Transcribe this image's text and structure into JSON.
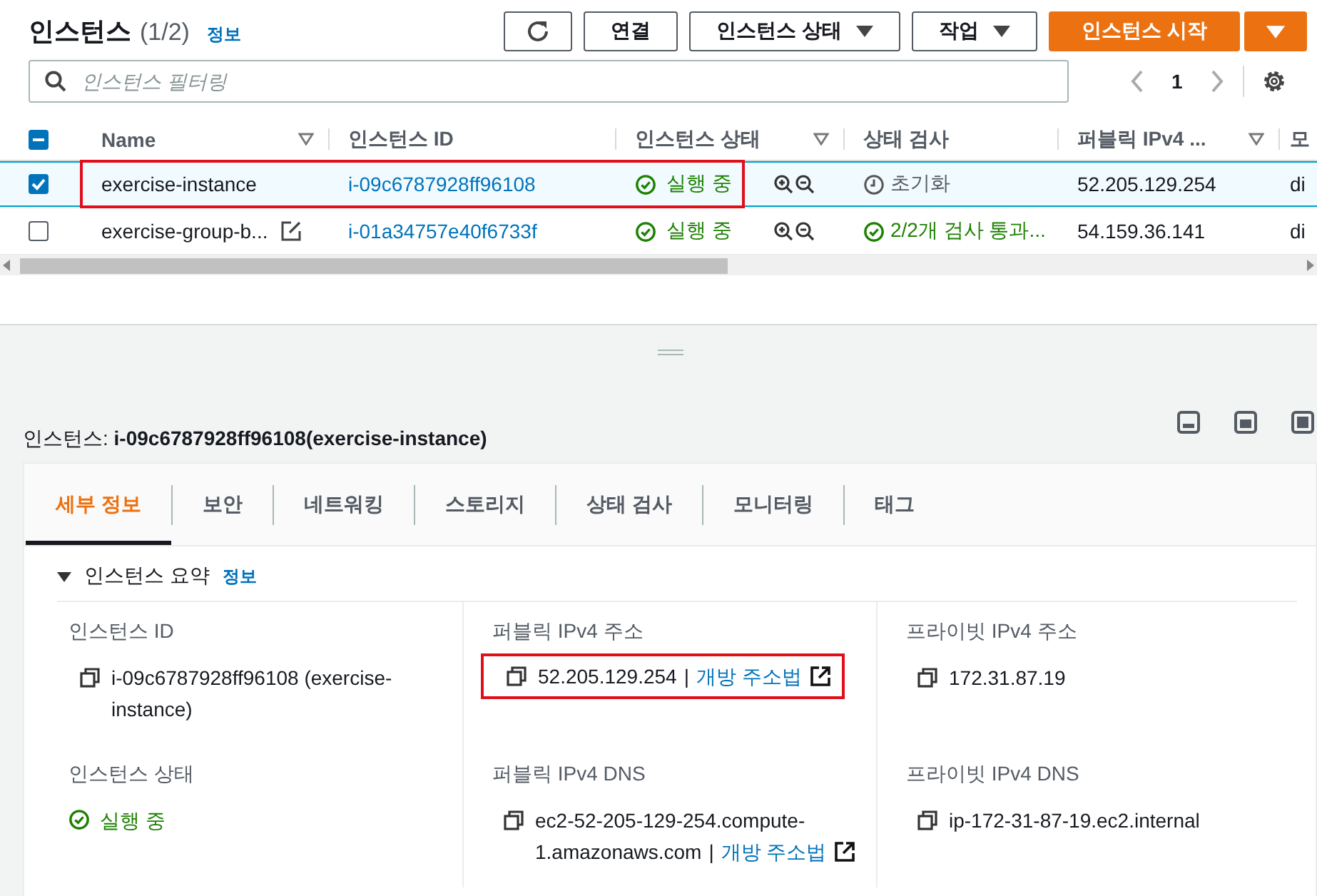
{
  "header": {
    "title": "인스턴스",
    "count": "(1/2)",
    "info": "정보"
  },
  "actions": [
    {
      "kind": "icon"
    },
    {
      "kind": "plain",
      "label": "연결"
    },
    {
      "kind": "dropdown",
      "label": "인스턴스 상태"
    },
    {
      "kind": "dropdown",
      "label": "작업"
    },
    {
      "kind": "primary",
      "label": "인스턴스 시작"
    },
    {
      "kind": "primary-caret"
    }
  ],
  "filter": {
    "placeholder": "인스턴스 필터링"
  },
  "pagination": {
    "page": "1"
  },
  "table": {
    "partially_checked": true,
    "columns": [
      {
        "label": "Name",
        "filter": true
      },
      {
        "label": "인스턴스 ID",
        "filter": false
      },
      {
        "label": "인스턴스 상태",
        "filter": true
      },
      {
        "label": "상태 검사",
        "filter": false
      },
      {
        "label": "퍼블릭 IPv4 ...",
        "filter": true
      },
      {
        "label": "모",
        "filter": false
      }
    ],
    "rows": [
      {
        "selected": true,
        "highlighted": true,
        "name": "exercise-instance",
        "editable": false,
        "id": "i-09c6787928ff96108",
        "state": "실행 중",
        "check": {
          "kind": "pending",
          "text": "초기화"
        },
        "ip": "52.205.129.254",
        "column_7": "di"
      },
      {
        "selected": false,
        "highlighted": false,
        "name": "exercise-group-b...",
        "editable": true,
        "id": "i-01a34757e40f6733f",
        "state": "실행 중",
        "check": {
          "kind": "passed",
          "text": "2/2개 검사 통과..."
        },
        "ip": "54.159.36.141",
        "column_7": "di"
      }
    ]
  },
  "detail": {
    "title": "인스턴스: **i-09c6787928ff96108(exercise-instance)**",
    "tabs": [
      {
        "label": "세부 정보",
        "selected": true
      },
      {
        "label": "보안",
        "selected": false
      },
      {
        "label": "네트워킹",
        "selected": false
      },
      {
        "label": "스토리지",
        "selected": false
      },
      {
        "label": "상태 검사",
        "selected": false
      },
      {
        "label": "모니터링",
        "selected": false
      },
      {
        "label": "태그",
        "selected": false
      }
    ],
    "section": {
      "title": "인스턴스 요약",
      "info": "정보",
      "expanded": true
    },
    "fields": [
      {
        "label": "인스턴스 ID",
        "kind": "copy",
        "value": "i-09c6787928ff96108 (exercise-instance)",
        "highlighted": false
      },
      {
        "label": "퍼블릭 IPv4 주소",
        "kind": "copy",
        "value": "52.205.129.254",
        "separator": "|",
        "link": "개방 주소법",
        "highlighted": true
      },
      {
        "label": "프라이빗 IPv4 주소",
        "kind": "copy",
        "value": "172.31.87.19",
        "highlighted": false
      },
      {
        "label": "인스턴스 상태",
        "kind": "status",
        "value": "실행 중",
        "highlighted": false
      },
      {
        "label": "퍼블릭 IPv4 DNS",
        "kind": "copy",
        "value": "ec2-52-205-129-254.compute-1.amazonaws.com",
        "separator": "|",
        "link": "개방 주소법",
        "highlighted": false
      },
      {
        "label": "프라이빗 IPv4 DNS",
        "kind": "copy",
        "value": "ip-172-31-87-19.ec2.internal",
        "highlighted": false
      }
    ]
  }
}
